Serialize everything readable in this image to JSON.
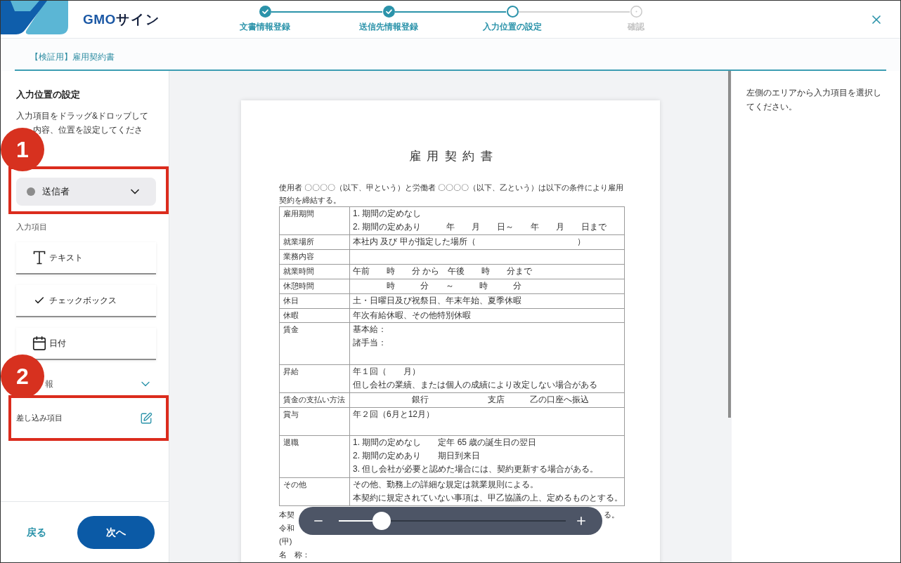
{
  "header": {
    "logo": {
      "latin": "GMO",
      "kana": "サイン"
    },
    "steps": [
      {
        "label": "文書情報登録",
        "selected": false
      },
      {
        "label": "送信先情報登録",
        "selected": false
      },
      {
        "label": "入力位置の設定",
        "selected": true
      },
      {
        "label": "確認",
        "selected": false
      }
    ]
  },
  "document_name": "【検証用】雇用契約書",
  "sidebar": {
    "title": "入力位置の設定",
    "description_lines": [
      "入力項目をドラッグ&ドロップして",
      "内容、位置を設定してくださ"
    ],
    "signer_select": {
      "value": "送信者",
      "color": "#8c8c8c",
      "highlighted": true
    },
    "items_label": "入力項目",
    "input_items": [
      {
        "kind": "text",
        "label": "テキスト"
      },
      {
        "kind": "checkbox",
        "label": "チェックボックス"
      },
      {
        "kind": "date",
        "label": "日付"
      }
    ],
    "section": {
      "label": "報"
    },
    "merge_item": {
      "label": "差し込み項目",
      "highlighted": true
    },
    "footer": {
      "back": "戻る",
      "next": "次へ"
    }
  },
  "callouts": [
    {
      "number": "1"
    },
    {
      "number": "2"
    }
  ],
  "document": {
    "title": "雇用契約書",
    "intro": "使用者 〇〇〇〇（以下、甲という）と労働者 〇〇〇〇（以下、乙という）は以下の条件により雇用契約を締結する。",
    "rows": [
      {
        "label": "雇用期間",
        "lines": [
          "1. 期間の定めなし",
          "2. 期間の定めあり　　　年　　月　　日～　　年　　月　　日まで"
        ]
      },
      {
        "label": "就業場所",
        "lines": [
          "本社内 及び 甲が指定した場所（　　　　　　　　　　　　）"
        ]
      },
      {
        "label": "業務内容"
      },
      {
        "label": "就業時間",
        "lines": [
          "午前　　時　　分 から　午後　　時　　分まで"
        ]
      },
      {
        "label": "休憩時間",
        "lines": [
          "　　　　時　　　分　　～　　　時　　　分"
        ]
      },
      {
        "label": "休日",
        "lines": [
          "土・日曜日及び祝祭日、年末年始、夏季休暇"
        ]
      },
      {
        "label": "休暇",
        "lines": [
          "年次有給休暇、その他特別休暇"
        ]
      },
      {
        "label": "賃金",
        "lines": [
          "基本給：",
          "諸手当："
        ]
      },
      {
        "label": "昇給",
        "lines": [
          "年１回（　　月）",
          "但し会社の業績、または個人の成績により改定しない場合がある"
        ]
      },
      {
        "label": "賃金の支払い方法",
        "lines": [
          "　　　　　　　銀行　　　　　　　支店　　　乙の口座へ振込"
        ]
      },
      {
        "label": "賞与",
        "lines": [
          "年２回（6月と12月）"
        ]
      },
      {
        "label": "退職",
        "lines": [
          "1. 期間の定めなし　　定年 65 歳の誕生日の翌日",
          "2. 期間の定めあり　　期日到来日",
          "3. 但し会社が必要と認めた場合には、契約更新する場合がある。"
        ]
      },
      {
        "label": "その他",
        "lines": [
          "その他、勤務上の詳細な規定は就業規則による。",
          "本契約に規定されていない事項は、甲乙協議の上、定めるものとする。"
        ]
      }
    ],
    "closing": [
      {
        "kind": "covered",
        "left": "本契",
        "right": "る。"
      },
      {
        "kind": "covered",
        "left": "令和"
      },
      {
        "kind": "plain",
        "text": "(甲)"
      },
      {
        "kind": "plain",
        "text": "名　称："
      }
    ]
  },
  "zoom": {
    "level": 0.19
  },
  "right_panel": {
    "hint": "左側のエリアから入力項目を選択してください。"
  }
}
